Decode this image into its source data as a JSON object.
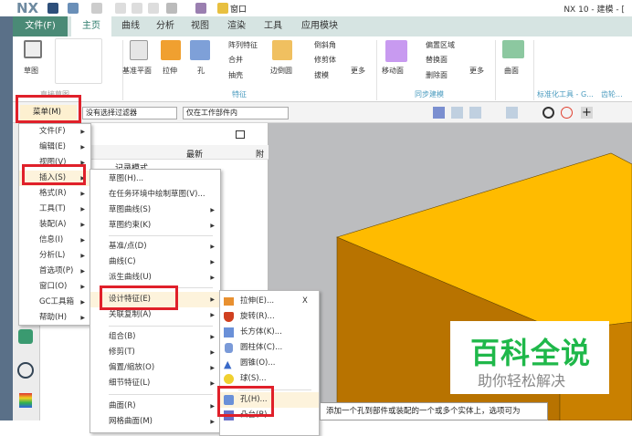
{
  "app": {
    "logo": "NX",
    "title": "NX 10 - 建模 - [",
    "quick_window": "窗口"
  },
  "tabs": [
    {
      "label": "文件(F)"
    },
    {
      "label": "主页"
    },
    {
      "label": "曲线"
    },
    {
      "label": "分析"
    },
    {
      "label": "视图"
    },
    {
      "label": "渲染"
    },
    {
      "label": "工具"
    },
    {
      "label": "应用模块"
    }
  ],
  "ribbon": {
    "sketch": "草图",
    "direct_sketch_group": "直接草图",
    "datum_plane": "基准平面",
    "extrude": "拉伸",
    "hole": "孔",
    "pattern": "阵列特征",
    "unite": "合并",
    "shell": "抽壳",
    "edge_blend": "边倒圆",
    "chamfer": "倒斜角",
    "trim_body": "修剪体",
    "draft": "拔模",
    "more1": "更多",
    "feature_group": "特征",
    "move_face": "移动面",
    "offset_region": "偏置区域",
    "replace_face": "替换面",
    "delete_face": "删除面",
    "more2": "更多",
    "sync_group": "同步建模",
    "surface": "曲面",
    "std_group": "标准化工具 - G...",
    "gear_group": "齿轮..."
  },
  "toolbar": {
    "menu_button": "菜单(M)",
    "filter": "没有选择过滤器",
    "scope": "仅在工作部件内"
  },
  "navigator": {
    "col_latest": "最新",
    "col_trunc": "附",
    "row_partial": "记录模式"
  },
  "main_menu": [
    {
      "label": "文件(F)"
    },
    {
      "label": "编辑(E)"
    },
    {
      "label": "视图(V)"
    },
    {
      "label": "插入(S)"
    },
    {
      "label": "格式(R)"
    },
    {
      "label": "工具(T)"
    },
    {
      "label": "装配(A)"
    },
    {
      "label": "信息(I)"
    },
    {
      "label": "分析(L)"
    },
    {
      "label": "首选项(P)"
    },
    {
      "label": "窗口(O)"
    },
    {
      "label": "GC工具箱"
    },
    {
      "label": "帮助(H)"
    }
  ],
  "insert_menu": [
    {
      "label": "草图(H)..."
    },
    {
      "label": "在任务环境中绘制草图(V)..."
    },
    {
      "label": "草图曲线(S)"
    },
    {
      "label": "草图约束(K)"
    },
    {
      "label": "基准/点(D)"
    },
    {
      "label": "曲线(C)"
    },
    {
      "label": "派生曲线(U)"
    },
    {
      "label": "设计特征(E)"
    },
    {
      "label": "关联复制(A)"
    },
    {
      "label": "组合(B)"
    },
    {
      "label": "修剪(T)"
    },
    {
      "label": "偏置/缩放(O)"
    },
    {
      "label": "细节特征(L)"
    },
    {
      "label": "曲面(R)"
    },
    {
      "label": "网格曲面(M)"
    }
  ],
  "design_menu": [
    {
      "label": "拉伸(E)...",
      "close": "X"
    },
    {
      "label": "旋转(R)..."
    },
    {
      "label": "长方体(K)..."
    },
    {
      "label": "圆柱体(C)..."
    },
    {
      "label": "圆锥(O)..."
    },
    {
      "label": "球(S)..."
    },
    {
      "label": "孔(H)..."
    },
    {
      "label": "凸台(B)..."
    }
  ],
  "tooltip": "添加一个孔到部件或装配的一个或多个实体上，选项可为",
  "watermark": {
    "title": "百科全说",
    "subtitle": "助你轻松解决"
  },
  "colors": {
    "file_tab": "#4a8a76",
    "highlight_box": "#e0202a",
    "box_top": "#ffbb00",
    "box_front": "#b87300",
    "box_side": "#c98000",
    "watermark_green": "#1fb84a"
  }
}
